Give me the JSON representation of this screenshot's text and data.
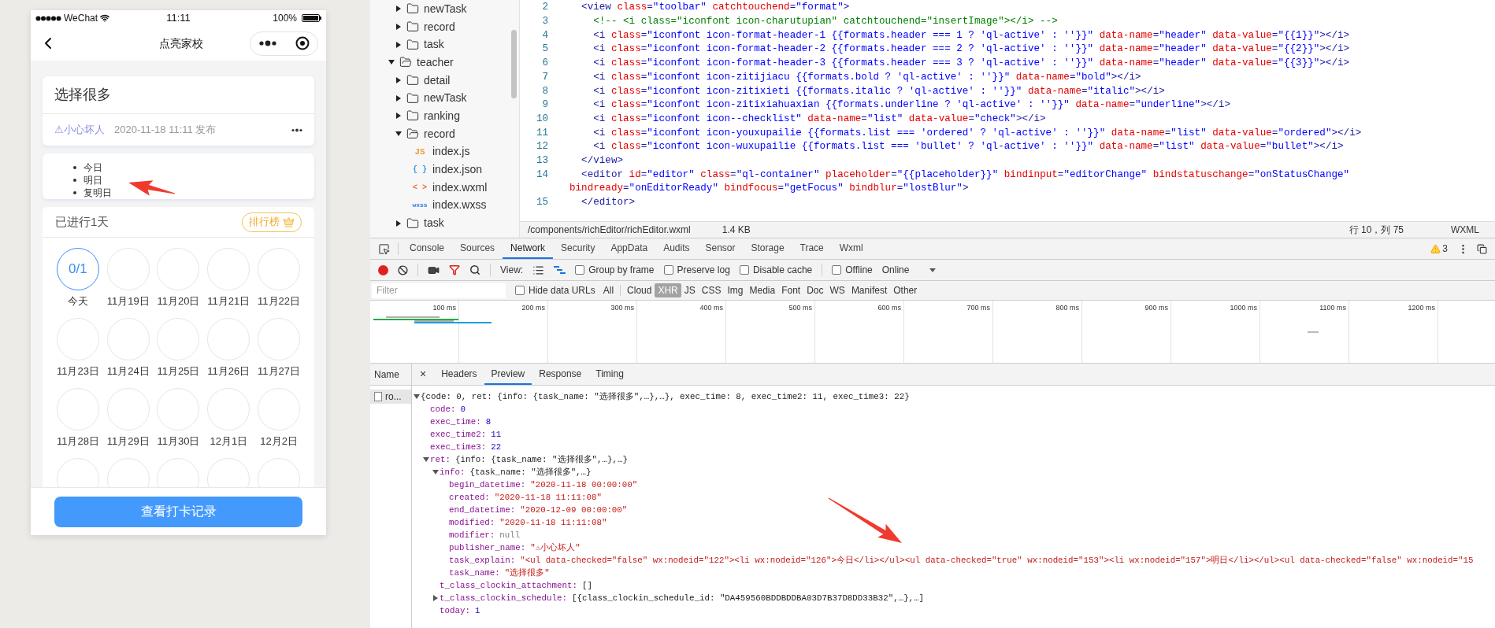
{
  "phone": {
    "status_bar": {
      "carrier": "WeChat",
      "time": "11:11",
      "battery": "100%"
    },
    "nav": {
      "title": "点亮家校"
    },
    "task_card": {
      "title": "选择很多",
      "publisher": "⚠小心坏人",
      "published": "2020-11-18 11:11 发布"
    },
    "checklist": [
      "今日",
      "明日",
      "复明日"
    ],
    "progress": {
      "title": "已进行1天",
      "ranking_button": "排行榜",
      "days": [
        {
          "label": "今天",
          "count": "0/1",
          "selected": true
        },
        {
          "label": "11月19日",
          "selected": false
        },
        {
          "label": "11月20日",
          "selected": false
        },
        {
          "label": "11月21日",
          "selected": false
        },
        {
          "label": "11月22日",
          "selected": false
        },
        {
          "label": "11月23日",
          "selected": false
        },
        {
          "label": "11月24日",
          "selected": false
        },
        {
          "label": "11月25日",
          "selected": false
        },
        {
          "label": "11月26日",
          "selected": false
        },
        {
          "label": "11月27日",
          "selected": false
        },
        {
          "label": "11月28日",
          "selected": false
        },
        {
          "label": "11月29日",
          "selected": false
        },
        {
          "label": "11月30日",
          "selected": false
        },
        {
          "label": "12月1日",
          "selected": false
        },
        {
          "label": "12月2日",
          "selected": false
        }
      ]
    },
    "bottom_button": "查看打卡记录"
  },
  "file_tree": [
    {
      "children": [
        {
          "name": "newTask",
          "kind": "folder",
          "expanded": false
        },
        {
          "name": "record",
          "kind": "folder",
          "expanded": false
        },
        {
          "name": "task",
          "kind": "folder",
          "expanded": false
        }
      ]
    },
    {
      "name": "teacher",
      "kind": "folder",
      "expanded": true,
      "children": [
        {
          "name": "detail",
          "kind": "folder",
          "expanded": false
        },
        {
          "name": "newTask",
          "kind": "folder",
          "expanded": false
        },
        {
          "name": "ranking",
          "kind": "folder",
          "expanded": false
        },
        {
          "name": "record",
          "kind": "folder",
          "expanded": true,
          "children": [
            {
              "name": "index.js",
              "kind": "js",
              "icon": "JS"
            },
            {
              "name": "index.json",
              "kind": "json",
              "icon": "{ }"
            },
            {
              "name": "index.wxml",
              "kind": "wxml",
              "icon": "< >"
            },
            {
              "name": "index.wxss",
              "kind": "wxss",
              "icon": "wxss"
            }
          ]
        },
        {
          "name": "task",
          "kind": "folder",
          "expanded": false
        }
      ]
    }
  ],
  "editor": {
    "lines": [
      {
        "number": "2",
        "kind": "code",
        "text": "  <view class=\"toolbar\" catchtouchend=\"format\">"
      },
      {
        "number": "3",
        "kind": "comment",
        "text": "    <!-- <i class=\"iconfont icon-charutupian\" catchtouchend=\"insertImage\"></i> -->"
      },
      {
        "number": "4",
        "kind": "code",
        "text": "    <i class=\"iconfont icon-format-header-1 {{formats.header === 1 ? 'ql-active' : ''}}\" data-name=\"header\" data-value=\"{{1}}\"></i>"
      },
      {
        "number": "5",
        "kind": "code",
        "text": "    <i class=\"iconfont icon-format-header-2 {{formats.header === 2 ? 'ql-active' : ''}}\" data-name=\"header\" data-value=\"{{2}}\"></i>"
      },
      {
        "number": "6",
        "kind": "code",
        "text": "    <i class=\"iconfont icon-format-header-3 {{formats.header === 3 ? 'ql-active' : ''}}\" data-name=\"header\" data-value=\"{{3}}\"></i>"
      },
      {
        "number": "7",
        "kind": "code",
        "text": "    <i class=\"iconfont icon-zitijiacu {{formats.bold ? 'ql-active' : ''}}\" data-name=\"bold\"></i>"
      },
      {
        "number": "8",
        "kind": "code",
        "text": "    <i class=\"iconfont icon-zitixieti {{formats.italic ? 'ql-active' : ''}}\" data-name=\"italic\"></i>"
      },
      {
        "number": "9",
        "kind": "code",
        "text": "    <i class=\"iconfont icon-zitixiahuaxian {{formats.underline ? 'ql-active' : ''}}\" data-name=\"underline\"></i>"
      },
      {
        "number": "10",
        "kind": "code",
        "text": "    <i class=\"iconfont icon--checklist\" data-name=\"list\" data-value=\"check\"></i>"
      },
      {
        "number": "11",
        "kind": "code",
        "text": "    <i class=\"iconfont icon-youxupailie {{formats.list === 'ordered' ? 'ql-active' : ''}}\" data-name=\"list\" data-value=\"ordered\"></i>"
      },
      {
        "number": "12",
        "kind": "code",
        "text": "    <i class=\"iconfont icon-wuxupailie {{formats.list === 'bullet' ? 'ql-active' : ''}}\" data-name=\"list\" data-value=\"bullet\"></i>"
      },
      {
        "number": "13",
        "kind": "code",
        "text": "  </view>"
      },
      {
        "number": "14",
        "kind": "code",
        "text": "  <editor id=\"editor\" class=\"ql-container\" placeholder=\"{{placeholder}}\" bindinput=\"editorChange\" bindstatuschange=\"onStatusChange\"",
        "wrap": "bindready=\"onEditorReady\" bindfocus=\"getFocus\" bindblur=\"lostBlur\">"
      },
      {
        "number": "15",
        "kind": "code",
        "text": "  </editor>"
      }
    ],
    "status": {
      "path": "/components/richEditor/richEditor.wxml",
      "size": "1.4 KB",
      "cursor": "行 10，列 75",
      "language": "WXML"
    }
  },
  "devtools": {
    "tabs": [
      {
        "label": "Console",
        "selected": false
      },
      {
        "label": "Sources",
        "selected": false
      },
      {
        "label": "Network",
        "selected": true
      },
      {
        "label": "Security",
        "selected": false
      },
      {
        "label": "AppData",
        "selected": false
      },
      {
        "label": "Audits",
        "selected": false
      },
      {
        "label": "Sensor",
        "selected": false
      },
      {
        "label": "Storage",
        "selected": false
      },
      {
        "label": "Trace",
        "selected": false
      },
      {
        "label": "Wxml",
        "selected": false
      }
    ],
    "warnings": "3",
    "toolbar": {
      "view_label": "View:",
      "checkboxes": [
        {
          "label": "Group by frame",
          "checked": false
        },
        {
          "label": "Preserve log",
          "checked": false
        },
        {
          "label": "Disable cache",
          "checked": false
        },
        {
          "label": "Offline",
          "checked": false
        }
      ],
      "throttle": "Online"
    },
    "filter": {
      "placeholder": "Filter",
      "hide_data_urls": {
        "label": "Hide data URLs",
        "checked": false
      },
      "types": [
        {
          "label": "All",
          "selected": false
        },
        {
          "label": "Cloud",
          "selected": false
        },
        {
          "label": "XHR",
          "selected": true
        },
        {
          "label": "JS",
          "selected": false
        },
        {
          "label": "CSS",
          "selected": false
        },
        {
          "label": "Img",
          "selected": false
        },
        {
          "label": "Media",
          "selected": false
        },
        {
          "label": "Font",
          "selected": false
        },
        {
          "label": "Doc",
          "selected": false
        },
        {
          "label": "WS",
          "selected": false
        },
        {
          "label": "Manifest",
          "selected": false
        },
        {
          "label": "Other",
          "selected": false
        }
      ]
    },
    "timeline": {
      "ticks": [
        "100 ms",
        "200 ms",
        "300 ms",
        "400 ms",
        "500 ms",
        "600 ms",
        "700 ms",
        "800 ms",
        "900 ms",
        "1000 ms",
        "1100 ms",
        "1200 ms"
      ]
    },
    "requests": {
      "column": "Name",
      "rows": [
        {
          "name": "ro...",
          "selected": true
        }
      ]
    },
    "detail_tabs": [
      {
        "label": "Headers",
        "selected": false
      },
      {
        "label": "Preview",
        "selected": true
      },
      {
        "label": "Response",
        "selected": false
      },
      {
        "label": "Timing",
        "selected": false
      }
    ],
    "close": "×",
    "preview": [
      {
        "summary": "{code: 0, ret: {info: {task_name: \"选择很多\",…},…}, exec_time: 8, exec_time2: 11, exec_time3: 22}",
        "expanded": true,
        "children": [
          {
            "key": "code:",
            "value": "0",
            "kind": "number"
          },
          {
            "key": "exec_time:",
            "value": "8",
            "kind": "number"
          },
          {
            "key": "exec_time2:",
            "value": "11",
            "kind": "number"
          },
          {
            "key": "exec_time3:",
            "value": "22",
            "kind": "number"
          },
          {
            "key": "ret:",
            "summary": "{info: {task_name: \"选择很多\",…},…}",
            "expanded": true,
            "children": [
              {
                "key": "info:",
                "summary": "{task_name: \"选择很多\",…}",
                "expanded": true,
                "children": [
                  {
                    "key": "begin_datetime:",
                    "value": "\"2020-11-18 00:00:00\"",
                    "kind": "string"
                  },
                  {
                    "key": "created:",
                    "value": "\"2020-11-18 11:11:08\"",
                    "kind": "string"
                  },
                  {
                    "key": "end_datetime:",
                    "value": "\"2020-12-09 00:00:00\"",
                    "kind": "string"
                  },
                  {
                    "key": "modified:",
                    "value": "\"2020-11-18 11:11:08\"",
                    "kind": "string"
                  },
                  {
                    "key": "modifier:",
                    "value": "null",
                    "kind": "null"
                  },
                  {
                    "key": "publisher_name:",
                    "value": "\"⚠小心坏人\"",
                    "kind": "string"
                  },
                  {
                    "key": "task_explain:",
                    "value": "\"<ul data-checked=\"false\" wx:nodeid=\"122\"><li wx:nodeid=\"126\">今日</li></ul><ul data-checked=\"true\" wx:nodeid=\"153\"><li wx:nodeid=\"157\">明日</li></ul><ul data-checked=\"false\" wx:nodeid=\"15",
                    "kind": "string"
                  },
                  {
                    "key": "task_name:",
                    "value": "\"选择很多\"",
                    "kind": "string"
                  }
                ]
              },
              {
                "key": "t_class_clockin_attachment:",
                "value": "[]",
                "kind": "plain"
              },
              {
                "key": "t_class_clockin_schedule:",
                "summary": "[{class_clockin_schedule_id: \"DA459560BDDBDDBA03D7B37D8DD33B32\",…},…]",
                "expanded": false
              },
              {
                "key": "today:",
                "value": "1",
                "kind": "number"
              }
            ]
          }
        ]
      }
    ]
  }
}
